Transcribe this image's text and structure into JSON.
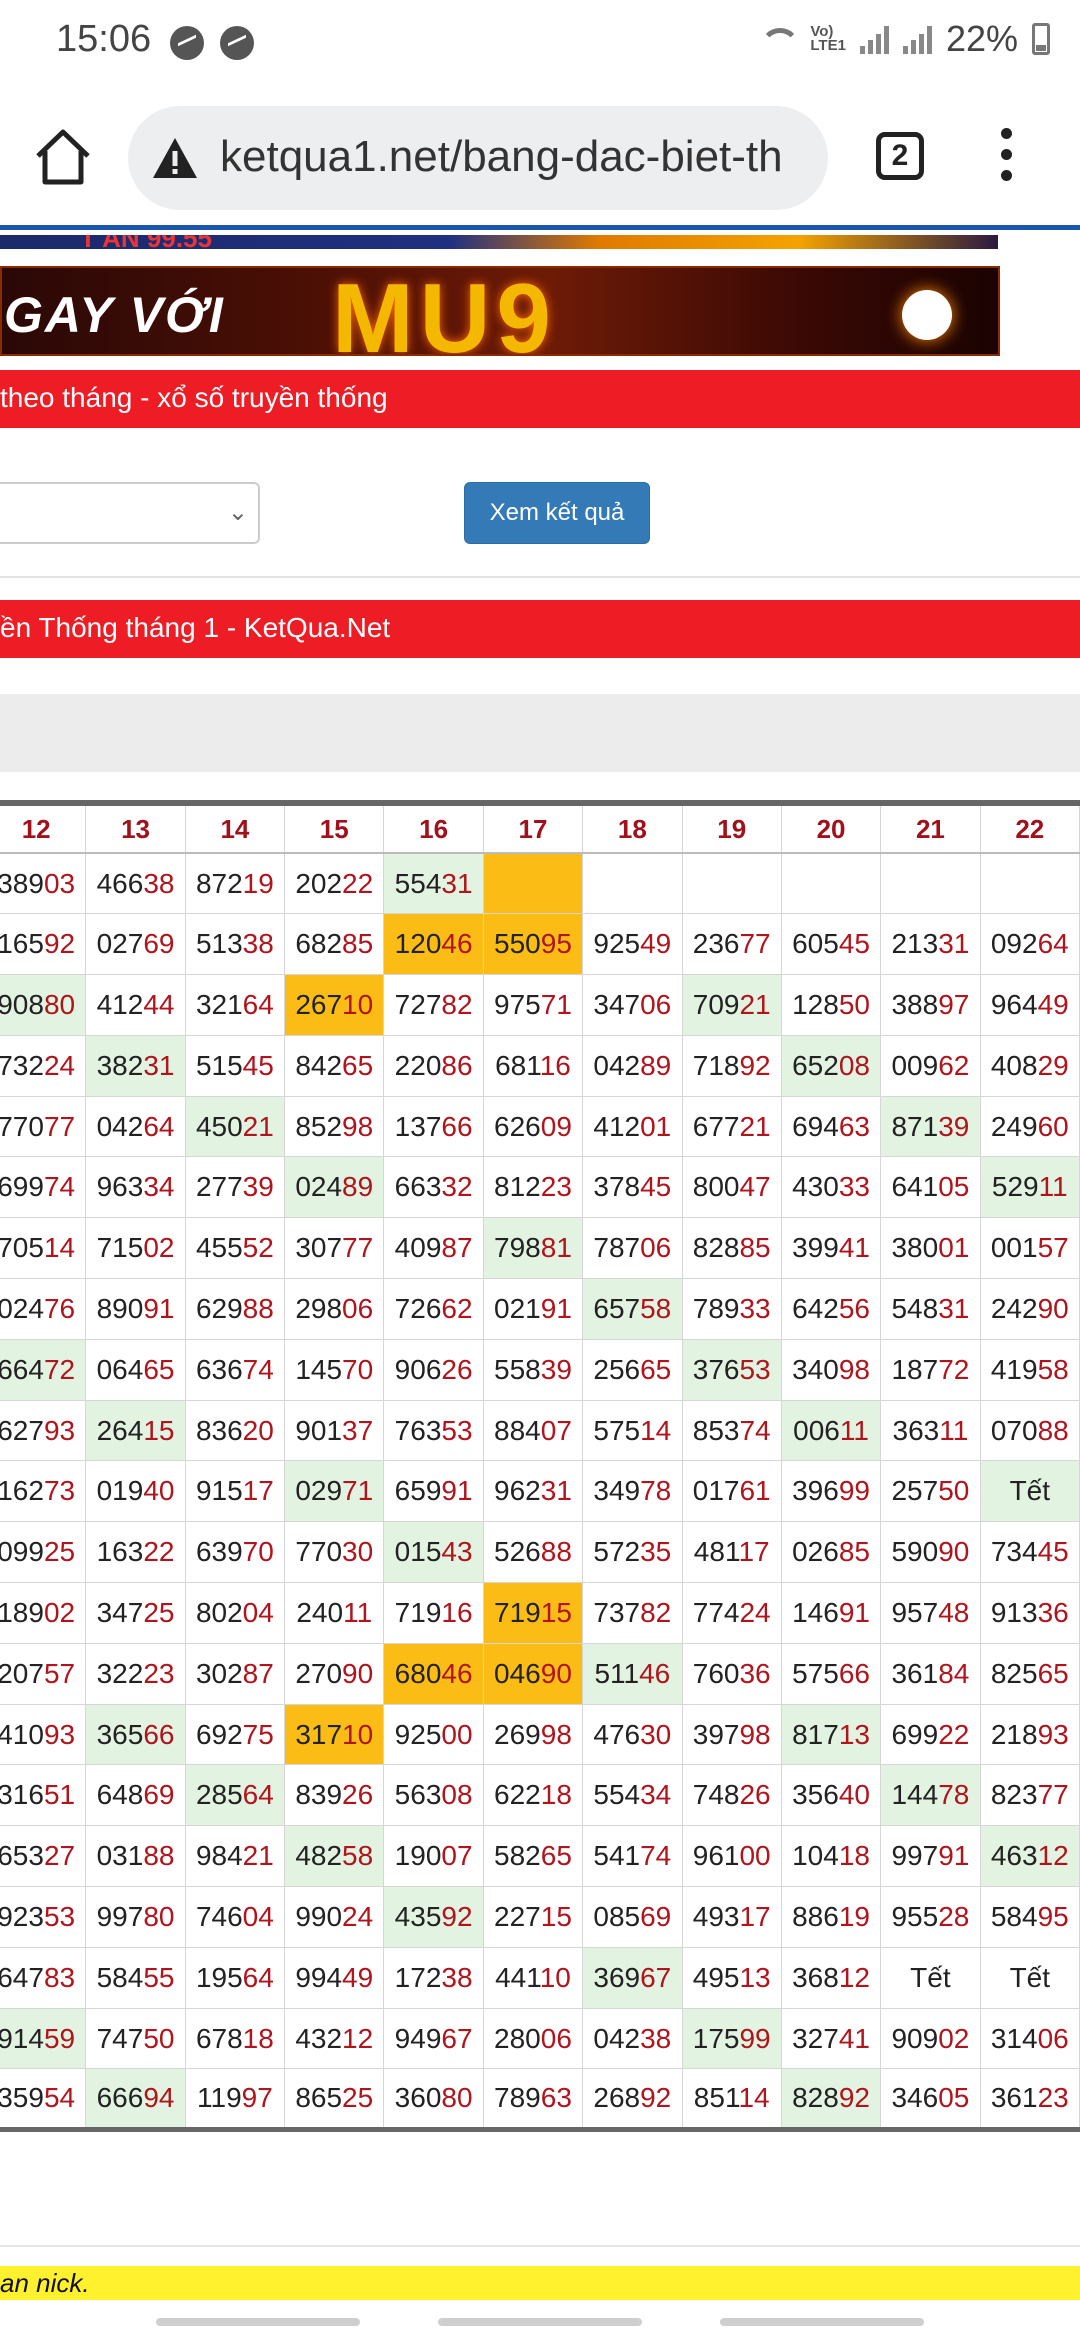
{
  "status": {
    "time": "15:06",
    "battery": "22%",
    "volte": "Vo)\nLTE1"
  },
  "browser": {
    "url": "ketqua1.net/bang-dac-biet-th",
    "tab_count": "2"
  },
  "banner": {
    "top_text": "T AN 99.55",
    "left_text": "GAY VỚI",
    "brand_text": "MU9"
  },
  "section1": {
    "title": "theo tháng - xổ số truyền thống"
  },
  "form": {
    "select_value": "",
    "submit_label": "Xem kết quả"
  },
  "section2": {
    "title": "ền Thống tháng 1 - KetQua.Net"
  },
  "table": {
    "headers": [
      "12",
      "13",
      "14",
      "15",
      "16",
      "17",
      "18",
      "19",
      "20",
      "21",
      "22"
    ],
    "rows": [
      [
        {
          "v": "38903"
        },
        {
          "v": "46638"
        },
        {
          "v": "87219"
        },
        {
          "v": "20222"
        },
        {
          "v": "55431",
          "h": "g"
        },
        {
          "v": "",
          "h": "o"
        },
        {
          "v": ""
        },
        {
          "v": ""
        },
        {
          "v": ""
        },
        {
          "v": ""
        },
        {
          "v": ""
        }
      ],
      [
        {
          "v": "16592"
        },
        {
          "v": "02769"
        },
        {
          "v": "51338"
        },
        {
          "v": "68285"
        },
        {
          "v": "12046",
          "h": "o"
        },
        {
          "v": "55095",
          "h": "o"
        },
        {
          "v": "92549"
        },
        {
          "v": "23677"
        },
        {
          "v": "60545"
        },
        {
          "v": "21331"
        },
        {
          "v": "09264"
        }
      ],
      [
        {
          "v": "90880",
          "h": "g"
        },
        {
          "v": "41244"
        },
        {
          "v": "32164"
        },
        {
          "v": "26710",
          "h": "o"
        },
        {
          "v": "72782"
        },
        {
          "v": "97571"
        },
        {
          "v": "34706"
        },
        {
          "v": "70921",
          "h": "g"
        },
        {
          "v": "12850"
        },
        {
          "v": "38897"
        },
        {
          "v": "96449"
        }
      ],
      [
        {
          "v": "73224"
        },
        {
          "v": "38231",
          "h": "g"
        },
        {
          "v": "51545"
        },
        {
          "v": "84265"
        },
        {
          "v": "22086"
        },
        {
          "v": "68116"
        },
        {
          "v": "04289"
        },
        {
          "v": "71892"
        },
        {
          "v": "65208",
          "h": "g"
        },
        {
          "v": "00962"
        },
        {
          "v": "40829"
        }
      ],
      [
        {
          "v": "77077"
        },
        {
          "v": "04264"
        },
        {
          "v": "45021",
          "h": "g"
        },
        {
          "v": "85298"
        },
        {
          "v": "13766"
        },
        {
          "v": "62609"
        },
        {
          "v": "41201"
        },
        {
          "v": "67721"
        },
        {
          "v": "69463"
        },
        {
          "v": "87139",
          "h": "g"
        },
        {
          "v": "24960"
        }
      ],
      [
        {
          "v": "69974"
        },
        {
          "v": "96334"
        },
        {
          "v": "27739"
        },
        {
          "v": "02489",
          "h": "g"
        },
        {
          "v": "66332"
        },
        {
          "v": "81223"
        },
        {
          "v": "37845"
        },
        {
          "v": "80047"
        },
        {
          "v": "43033"
        },
        {
          "v": "64105"
        },
        {
          "v": "52911",
          "h": "g"
        }
      ],
      [
        {
          "v": "70514"
        },
        {
          "v": "71502"
        },
        {
          "v": "45552"
        },
        {
          "v": "30777"
        },
        {
          "v": "40987"
        },
        {
          "v": "79881",
          "h": "g"
        },
        {
          "v": "78706"
        },
        {
          "v": "82885"
        },
        {
          "v": "39941"
        },
        {
          "v": "38001"
        },
        {
          "v": "00157"
        }
      ],
      [
        {
          "v": "02476"
        },
        {
          "v": "89091"
        },
        {
          "v": "62988"
        },
        {
          "v": "29806"
        },
        {
          "v": "72662"
        },
        {
          "v": "02191"
        },
        {
          "v": "65758",
          "h": "g"
        },
        {
          "v": "78933"
        },
        {
          "v": "64256"
        },
        {
          "v": "54831"
        },
        {
          "v": "24290"
        }
      ],
      [
        {
          "v": "66472",
          "h": "g"
        },
        {
          "v": "06465"
        },
        {
          "v": "63674"
        },
        {
          "v": "14570"
        },
        {
          "v": "90626"
        },
        {
          "v": "55839"
        },
        {
          "v": "25665"
        },
        {
          "v": "37653",
          "h": "g"
        },
        {
          "v": "34098"
        },
        {
          "v": "18772"
        },
        {
          "v": "41958"
        }
      ],
      [
        {
          "v": "62793"
        },
        {
          "v": "26415",
          "h": "g"
        },
        {
          "v": "83620"
        },
        {
          "v": "90137"
        },
        {
          "v": "76353"
        },
        {
          "v": "88407"
        },
        {
          "v": "57514"
        },
        {
          "v": "85374"
        },
        {
          "v": "00611",
          "h": "g"
        },
        {
          "v": "36311"
        },
        {
          "v": "07088"
        }
      ],
      [
        {
          "v": "16273"
        },
        {
          "v": "01940"
        },
        {
          "v": "91517"
        },
        {
          "v": "02971",
          "h": "g"
        },
        {
          "v": "65991"
        },
        {
          "v": "96231"
        },
        {
          "v": "34978"
        },
        {
          "v": "01761"
        },
        {
          "v": "39699"
        },
        {
          "v": "25750"
        },
        {
          "v": "Tết",
          "h": "g"
        }
      ],
      [
        {
          "v": "09925"
        },
        {
          "v": "16322"
        },
        {
          "v": "63970"
        },
        {
          "v": "77030"
        },
        {
          "v": "01543",
          "h": "g"
        },
        {
          "v": "52688"
        },
        {
          "v": "57235"
        },
        {
          "v": "48117"
        },
        {
          "v": "02685"
        },
        {
          "v": "59090"
        },
        {
          "v": "73445"
        }
      ],
      [
        {
          "v": "18902"
        },
        {
          "v": "34725"
        },
        {
          "v": "80204"
        },
        {
          "v": "24011"
        },
        {
          "v": "71916"
        },
        {
          "v": "71915",
          "h": "o"
        },
        {
          "v": "73782"
        },
        {
          "v": "77424"
        },
        {
          "v": "14691"
        },
        {
          "v": "95748"
        },
        {
          "v": "91336"
        }
      ],
      [
        {
          "v": "20757"
        },
        {
          "v": "32223"
        },
        {
          "v": "30287"
        },
        {
          "v": "27090"
        },
        {
          "v": "68046",
          "h": "o"
        },
        {
          "v": "04690",
          "h": "o"
        },
        {
          "v": "51146",
          "h": "g"
        },
        {
          "v": "76036"
        },
        {
          "v": "57566"
        },
        {
          "v": "36184"
        },
        {
          "v": "82565"
        }
      ],
      [
        {
          "v": "41093"
        },
        {
          "v": "36566",
          "h": "g"
        },
        {
          "v": "69275"
        },
        {
          "v": "31710",
          "h": "o"
        },
        {
          "v": "92500"
        },
        {
          "v": "26998"
        },
        {
          "v": "47630"
        },
        {
          "v": "39798"
        },
        {
          "v": "81713",
          "h": "g"
        },
        {
          "v": "69922"
        },
        {
          "v": "21893"
        }
      ],
      [
        {
          "v": "31651"
        },
        {
          "v": "64869"
        },
        {
          "v": "28564",
          "h": "g"
        },
        {
          "v": "83926"
        },
        {
          "v": "56308"
        },
        {
          "v": "62218"
        },
        {
          "v": "55434"
        },
        {
          "v": "74826"
        },
        {
          "v": "35640"
        },
        {
          "v": "14478",
          "h": "g"
        },
        {
          "v": "82377"
        }
      ],
      [
        {
          "v": "65327"
        },
        {
          "v": "03188"
        },
        {
          "v": "98421"
        },
        {
          "v": "48258",
          "h": "g"
        },
        {
          "v": "19007"
        },
        {
          "v": "58265"
        },
        {
          "v": "54174"
        },
        {
          "v": "96100"
        },
        {
          "v": "10418"
        },
        {
          "v": "99791"
        },
        {
          "v": "46312",
          "h": "g"
        }
      ],
      [
        {
          "v": "92353"
        },
        {
          "v": "99780"
        },
        {
          "v": "74604"
        },
        {
          "v": "99024"
        },
        {
          "v": "43592",
          "h": "g"
        },
        {
          "v": "22715"
        },
        {
          "v": "08569"
        },
        {
          "v": "49317"
        },
        {
          "v": "88619"
        },
        {
          "v": "95528"
        },
        {
          "v": "58495"
        }
      ],
      [
        {
          "v": "64783"
        },
        {
          "v": "58455"
        },
        {
          "v": "19564"
        },
        {
          "v": "99449"
        },
        {
          "v": "17238"
        },
        {
          "v": "44110"
        },
        {
          "v": "36967",
          "h": "g"
        },
        {
          "v": "49513"
        },
        {
          "v": "36812"
        },
        {
          "v": "Tết"
        },
        {
          "v": "Tết"
        }
      ],
      [
        {
          "v": "91459",
          "h": "g"
        },
        {
          "v": "74750"
        },
        {
          "v": "67818"
        },
        {
          "v": "43212"
        },
        {
          "v": "94967"
        },
        {
          "v": "28006"
        },
        {
          "v": "04238"
        },
        {
          "v": "17599",
          "h": "g"
        },
        {
          "v": "32741"
        },
        {
          "v": "90902"
        },
        {
          "v": "31406"
        }
      ],
      [
        {
          "v": "35954"
        },
        {
          "v": "66694",
          "h": "g"
        },
        {
          "v": "11997"
        },
        {
          "v": "86525"
        },
        {
          "v": "36080"
        },
        {
          "v": "78963"
        },
        {
          "v": "26892"
        },
        {
          "v": "85114"
        },
        {
          "v": "82892",
          "h": "g"
        },
        {
          "v": "34605"
        },
        {
          "v": "36123"
        }
      ]
    ]
  },
  "footer": {
    "note": "an nick."
  },
  "colors": {
    "accent_red": "#ee1c25",
    "button_blue": "#337ab7",
    "highlight_green": "#e3f3e1",
    "highlight_orange": "#fbbd15",
    "tail_red": "#b0141c"
  }
}
